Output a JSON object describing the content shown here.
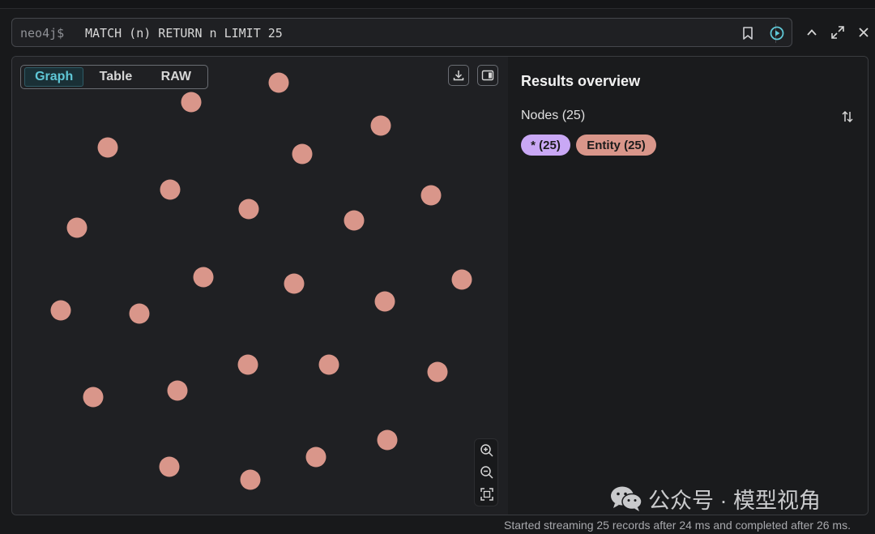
{
  "query": {
    "prompt": "neo4j$",
    "text": "MATCH (n) RETURN n LIMIT 25"
  },
  "icons": {
    "bookmark": "bookmark-icon",
    "run": "play-circle-icon",
    "collapse": "chevron-up-icon",
    "fullscreen": "expand-icon",
    "close": "close-icon",
    "download": "download-icon",
    "panel": "side-panel-icon",
    "zoom_in": "zoom-in-icon",
    "zoom_out": "zoom-out-icon",
    "fit": "fit-to-screen-icon",
    "sort": "sort-arrows-icon"
  },
  "view_tabs": [
    {
      "label": "Graph",
      "active": true
    },
    {
      "label": "Table",
      "active": false
    },
    {
      "label": "RAW",
      "active": false
    }
  ],
  "graph": {
    "node_color": "#d9968a",
    "node_count": 25
  },
  "overview": {
    "title": "Results overview",
    "nodes_label": "Nodes (25)",
    "labels": [
      {
        "text": "* (25)",
        "color": "#c9a8f5"
      },
      {
        "text": "Entity (25)",
        "color": "#d9968a"
      }
    ]
  },
  "status": {
    "text": "Started streaming 25 records after 24 ms and completed after 26 ms."
  },
  "watermark": {
    "text": "公众号 · 模型视角"
  },
  "colors": {
    "accent": "#5fc7d6",
    "background": "#1f2023"
  }
}
